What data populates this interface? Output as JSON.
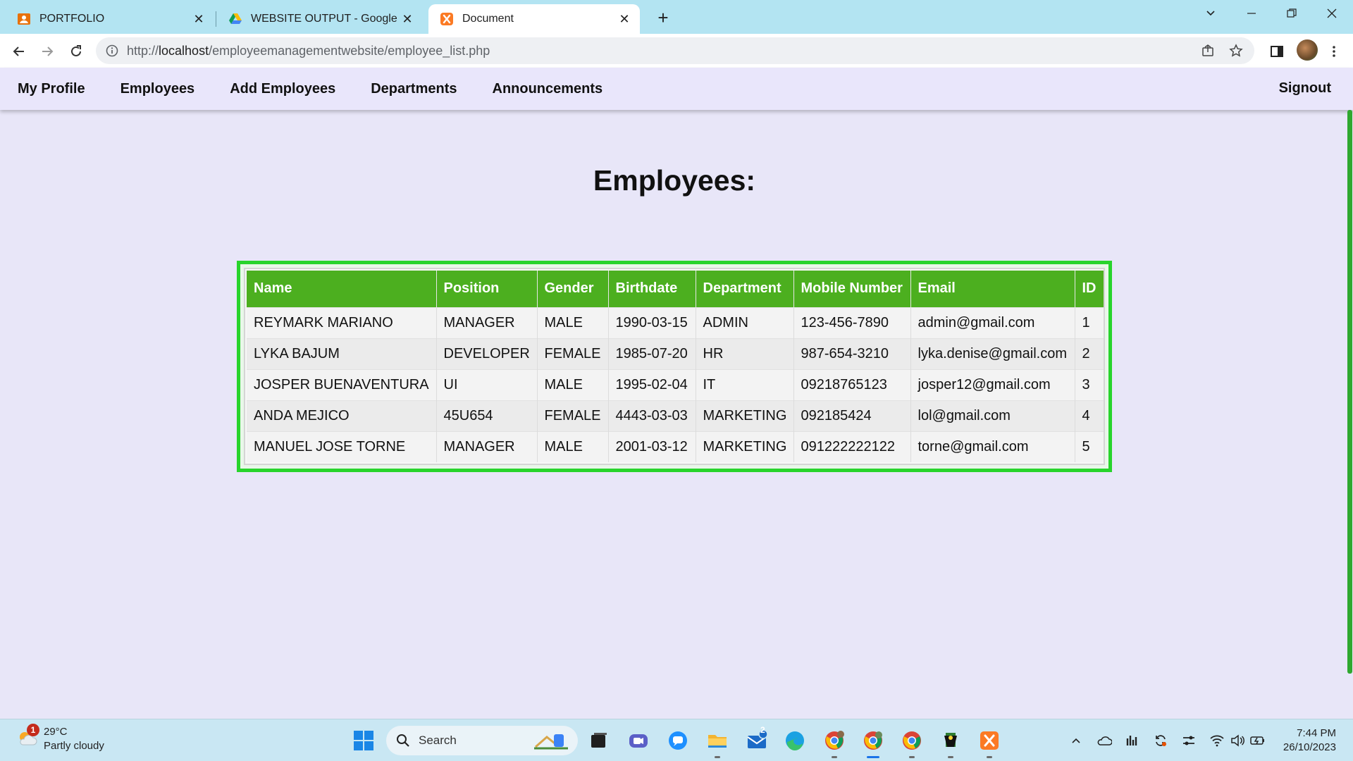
{
  "browser": {
    "tabs": [
      {
        "title": "PORTFOLIO",
        "icon": "portfolio-icon"
      },
      {
        "title": "WEBSITE OUTPUT - Google Drive",
        "icon": "google-drive-icon"
      },
      {
        "title": "Document",
        "icon": "xampp-icon"
      }
    ],
    "url_prefix": "http://",
    "url_host": "localhost",
    "url_path": "/employeemanagementwebsite/employee_list.php"
  },
  "nav": {
    "links": [
      "My Profile",
      "Employees",
      "Add Employees",
      "Departments",
      "Announcements"
    ],
    "signout": "Signout"
  },
  "page": {
    "heading": "Employees:"
  },
  "table": {
    "columns": [
      "Name",
      "Position",
      "Gender",
      "Birthdate",
      "Department",
      "Mobile Number",
      "Email",
      "ID"
    ],
    "rows": [
      [
        "REYMARK MARIANO",
        "MANAGER",
        "MALE",
        "1990-03-15",
        "ADMIN",
        "123-456-7890",
        "admin@gmail.com",
        "1"
      ],
      [
        "LYKA BAJUM",
        "DEVELOPER",
        "FEMALE",
        "1985-07-20",
        "HR",
        "987-654-3210",
        "lyka.denise@gmail.com",
        "2"
      ],
      [
        "JOSPER BUENAVENTURA",
        "UI",
        "MALE",
        "1995-02-04",
        "IT",
        "09218765123",
        "josper12@gmail.com",
        "3"
      ],
      [
        "ANDA MEJICO",
        "45U654",
        "FEMALE",
        "4443-03-03",
        "MARKETING",
        "092185424",
        "lol@gmail.com",
        "4"
      ],
      [
        "MANUEL JOSE TORNE",
        "MANAGER",
        "MALE",
        "2001-03-12",
        "MARKETING",
        "091222222122",
        "torne@gmail.com",
        "5"
      ]
    ]
  },
  "taskbar": {
    "weather_temp": "29°C",
    "weather_desc": "Partly cloudy",
    "weather_badge": "1",
    "search_placeholder": "Search",
    "mail_badge": "2",
    "time": "7:44 PM",
    "date": "26/10/2023"
  },
  "colors": {
    "table_header": "#4caf1f",
    "table_frame": "#28d42c",
    "page_bg": "#e8e6f8"
  }
}
